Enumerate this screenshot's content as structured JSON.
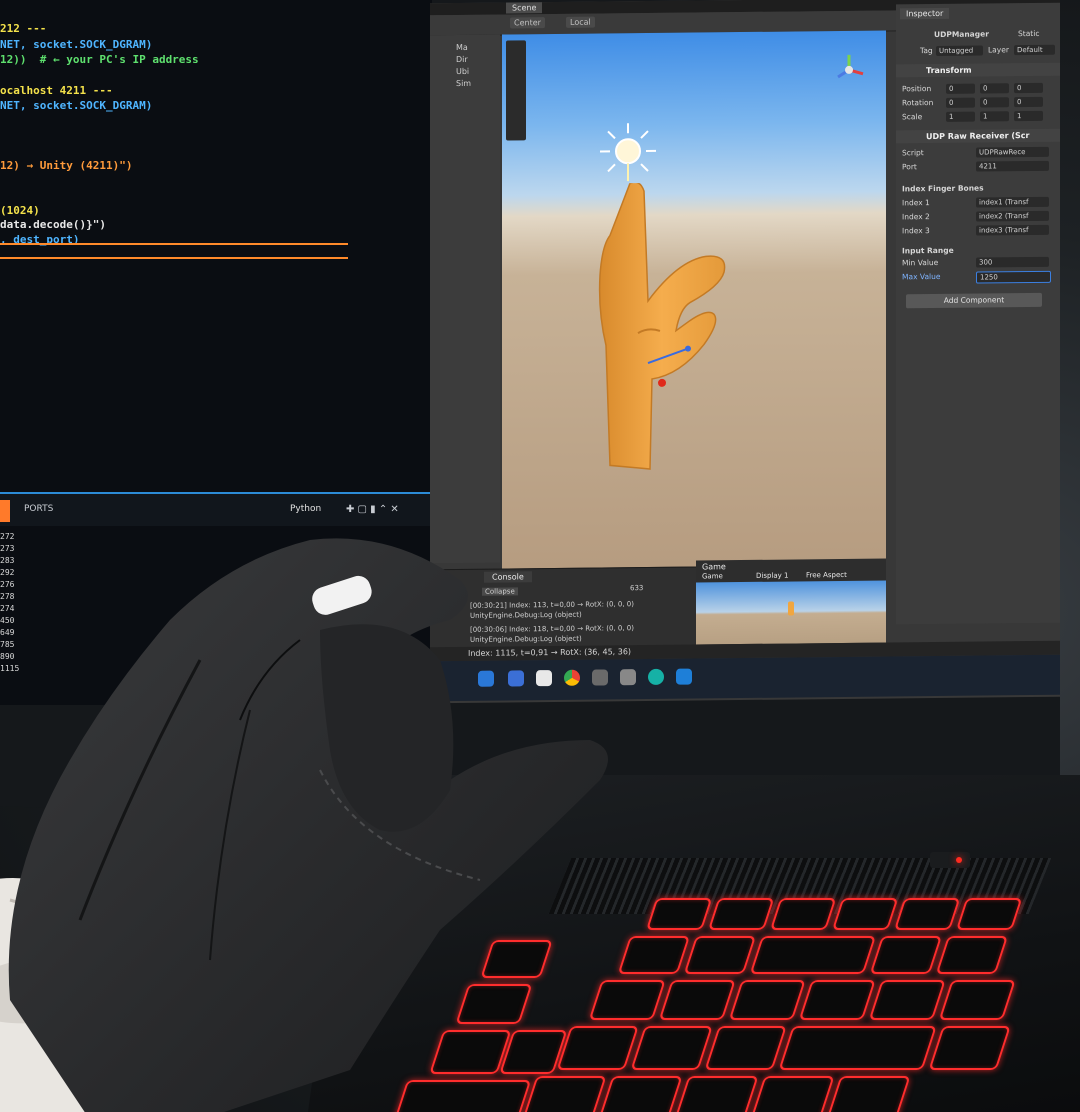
{
  "code": {
    "lines": [
      {
        "text": "212 ---",
        "color": "y"
      },
      {
        "text": "NET, socket.SOCK_DGRAM)",
        "color": "b"
      },
      {
        "text": "12))  # ← your PC's IP address",
        "color": "g"
      },
      {
        "text": "ocalhost 4211 ---",
        "color": "y"
      },
      {
        "text": "NET, socket.SOCK_DGRAM)",
        "color": "b"
      },
      {
        "text": "12) → Unity (4211)\")",
        "color": "o"
      },
      {
        "text": "(1024)",
        "color": "y"
      },
      {
        "text": "data.decode()}\")",
        "color": "w"
      },
      {
        "text": ", dest_port)",
        "color": "b"
      }
    ]
  },
  "terminal": {
    "tab_label": "PORTS",
    "right_label": "Python",
    "numbers": [
      "272",
      "273",
      "283",
      "292",
      "276",
      "278",
      "274",
      "450",
      "649",
      "785",
      "890",
      "1115"
    ]
  },
  "unity": {
    "scene_tab": "Scene",
    "toolbar": [
      "Center",
      "Local"
    ],
    "hierarchy_items": [
      "Ma",
      "Dir",
      "Ubi",
      "Sim"
    ],
    "inspector": {
      "tab": "Inspector",
      "object_name": "UDPManager",
      "static_label": "Static",
      "tag_label": "Tag",
      "tag_value": "Untagged",
      "layer_label": "Layer",
      "layer_value": "Default",
      "transform_title": "Transform",
      "position_label": "Position",
      "rotation_label": "Rotation",
      "scale_label": "Scale",
      "position": [
        "0",
        "0",
        "0"
      ],
      "rotation": [
        "0",
        "0",
        "0"
      ],
      "scale": [
        "1",
        "1",
        "1"
      ],
      "component_title": "UDP Raw Receiver (Scr",
      "script_label": "Script",
      "script_value": "UDPRawRece",
      "port_label": "Port",
      "port_value": "4211",
      "bones_title": "Index Finger Bones",
      "bones": [
        {
          "label": "Index 1",
          "value": "index1 (Transf"
        },
        {
          "label": "Index 2",
          "value": "index2 (Transf"
        },
        {
          "label": "Index 3",
          "value": "index3 (Transf"
        }
      ],
      "range_title": "Input Range",
      "min_label": "Min Value",
      "min_value": "300",
      "max_label": "Max Value",
      "max_value": "1250",
      "add_component": "Add Component"
    },
    "console": {
      "tab": "Console",
      "collapse": "Collapse",
      "count": "633",
      "lines": [
        "[00:30:21] Index: 113, t=0,00 → RotX: (0, 0, 0)",
        "UnityEngine.Debug:Log (object)",
        "[00:30:06] Index: 118, t=0,00 → RotX: (0, 0, 0)",
        "UnityEngine.Debug:Log (object)"
      ]
    },
    "game": {
      "tab": "Game",
      "label": "Game",
      "display": "Display 1",
      "aspect": "Free Aspect"
    },
    "status": "Index: 1115, t=0,91 → RotX: (36, 45, 36)"
  },
  "colors": {
    "keyboard_backlight": "#ff2d2d",
    "unity_panel": "#383838",
    "hand_model": "#f0a640"
  }
}
